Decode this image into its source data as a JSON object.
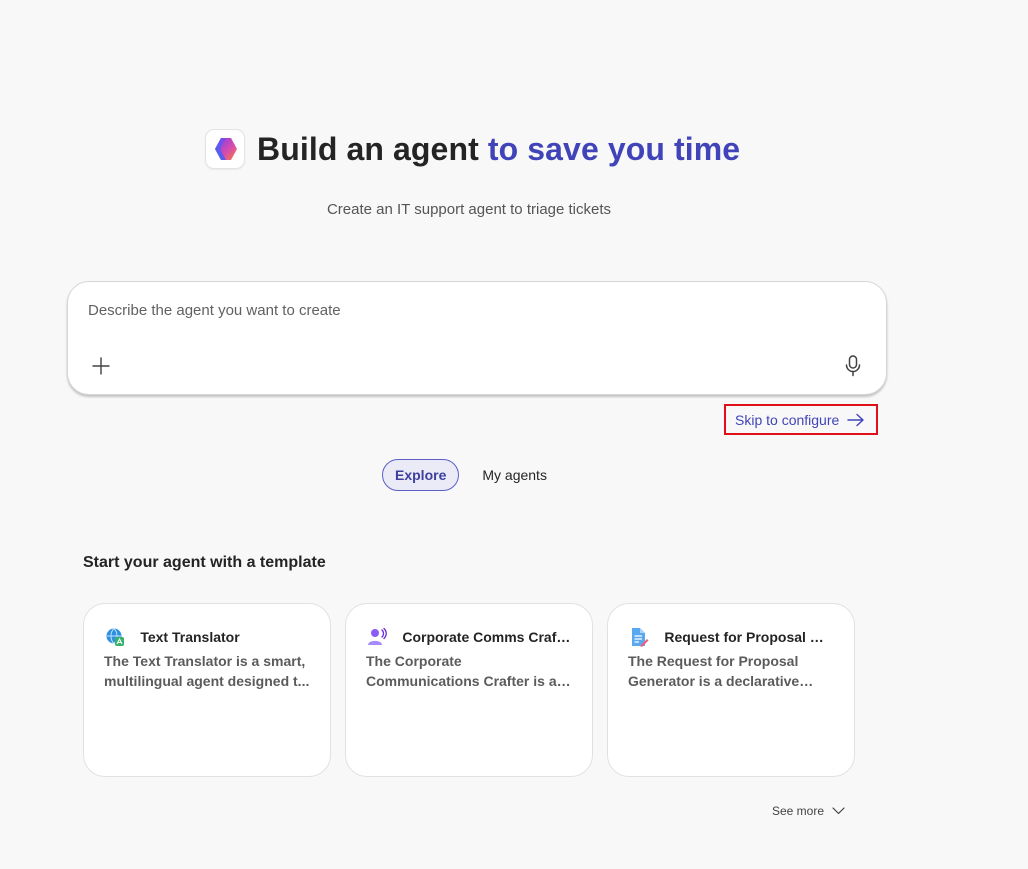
{
  "hero": {
    "title_main": "Build an agent",
    "title_accent": "to save you time",
    "logo_icon": "copilot-logo-icon"
  },
  "subtitle": "Create an IT support agent to triage tickets",
  "composer": {
    "placeholder": "Describe the agent you want to create",
    "value": "",
    "add_icon": "plus-icon",
    "mic_icon": "microphone-icon"
  },
  "skip": {
    "label": "Skip to configure",
    "icon": "arrow-right-icon"
  },
  "tabs": [
    {
      "label": "Explore",
      "active": true
    },
    {
      "label": "My agents",
      "active": false
    }
  ],
  "section_title": "Start your agent with a template",
  "templates": [
    {
      "title": "Text Translator",
      "description": "The Text Translator is a smart, multilingual agent designed t...",
      "icon": "globe-translate-icon"
    },
    {
      "title": "Corporate Comms Crafter",
      "description": "The Corporate Communications Crafter is a declarative agent...",
      "icon": "person-voice-icon"
    },
    {
      "title": "Request for Proposal Ge...",
      "description": "The Request for Proposal Generator is a declarative age...",
      "icon": "document-edit-icon"
    }
  ],
  "see_more": {
    "label": "See more",
    "icon": "chevron-down-icon"
  },
  "colors": {
    "accent": "#4044b8",
    "background": "#f8f8f8",
    "highlight_border": "#e0101a"
  }
}
